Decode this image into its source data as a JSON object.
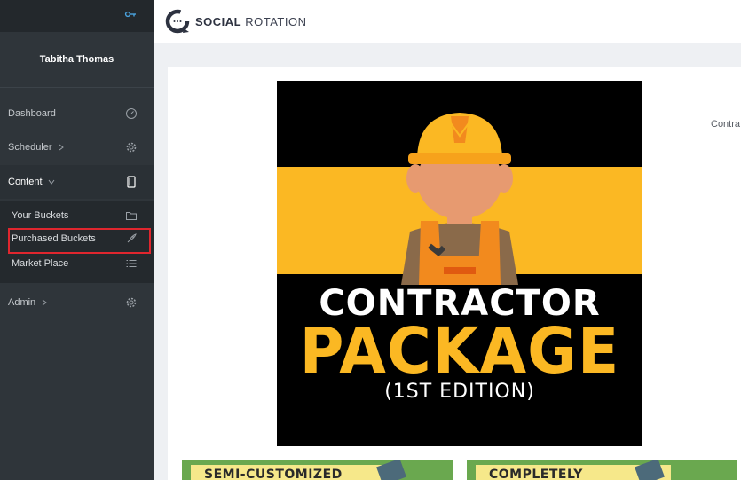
{
  "user": {
    "name": "Tabitha Thomas"
  },
  "sidebar": {
    "nav": [
      {
        "label": "Dashboard",
        "icon": "speedometer-icon"
      },
      {
        "label": "Scheduler",
        "icon": "gear-icon"
      },
      {
        "label": "Content",
        "icon": "tablet-icon"
      },
      {
        "label": "Admin",
        "icon": "gear-icon"
      }
    ],
    "content_sub": [
      {
        "label": "Your Buckets",
        "icon": "folder-icon"
      },
      {
        "label": "Purchased Buckets",
        "icon": "rocket-icon"
      },
      {
        "label": "Market Place",
        "icon": "list-icon"
      }
    ]
  },
  "brand": {
    "bold": "SOCIAL",
    "rest": " ROTATION"
  },
  "main": {
    "poster": {
      "line1": "CONTRACTOR",
      "line2": "PACKAGE",
      "line3": "(1ST EDITION)"
    },
    "side_text": "Contra",
    "thumbs": [
      {
        "label": "SEMI-CUSTOMIZED"
      },
      {
        "label": "COMPLETELY"
      }
    ]
  },
  "colors": {
    "accent": "#fbb823",
    "highlight": "#e0262e",
    "sidebar": "#2f353a",
    "key": "#4aa3df"
  }
}
